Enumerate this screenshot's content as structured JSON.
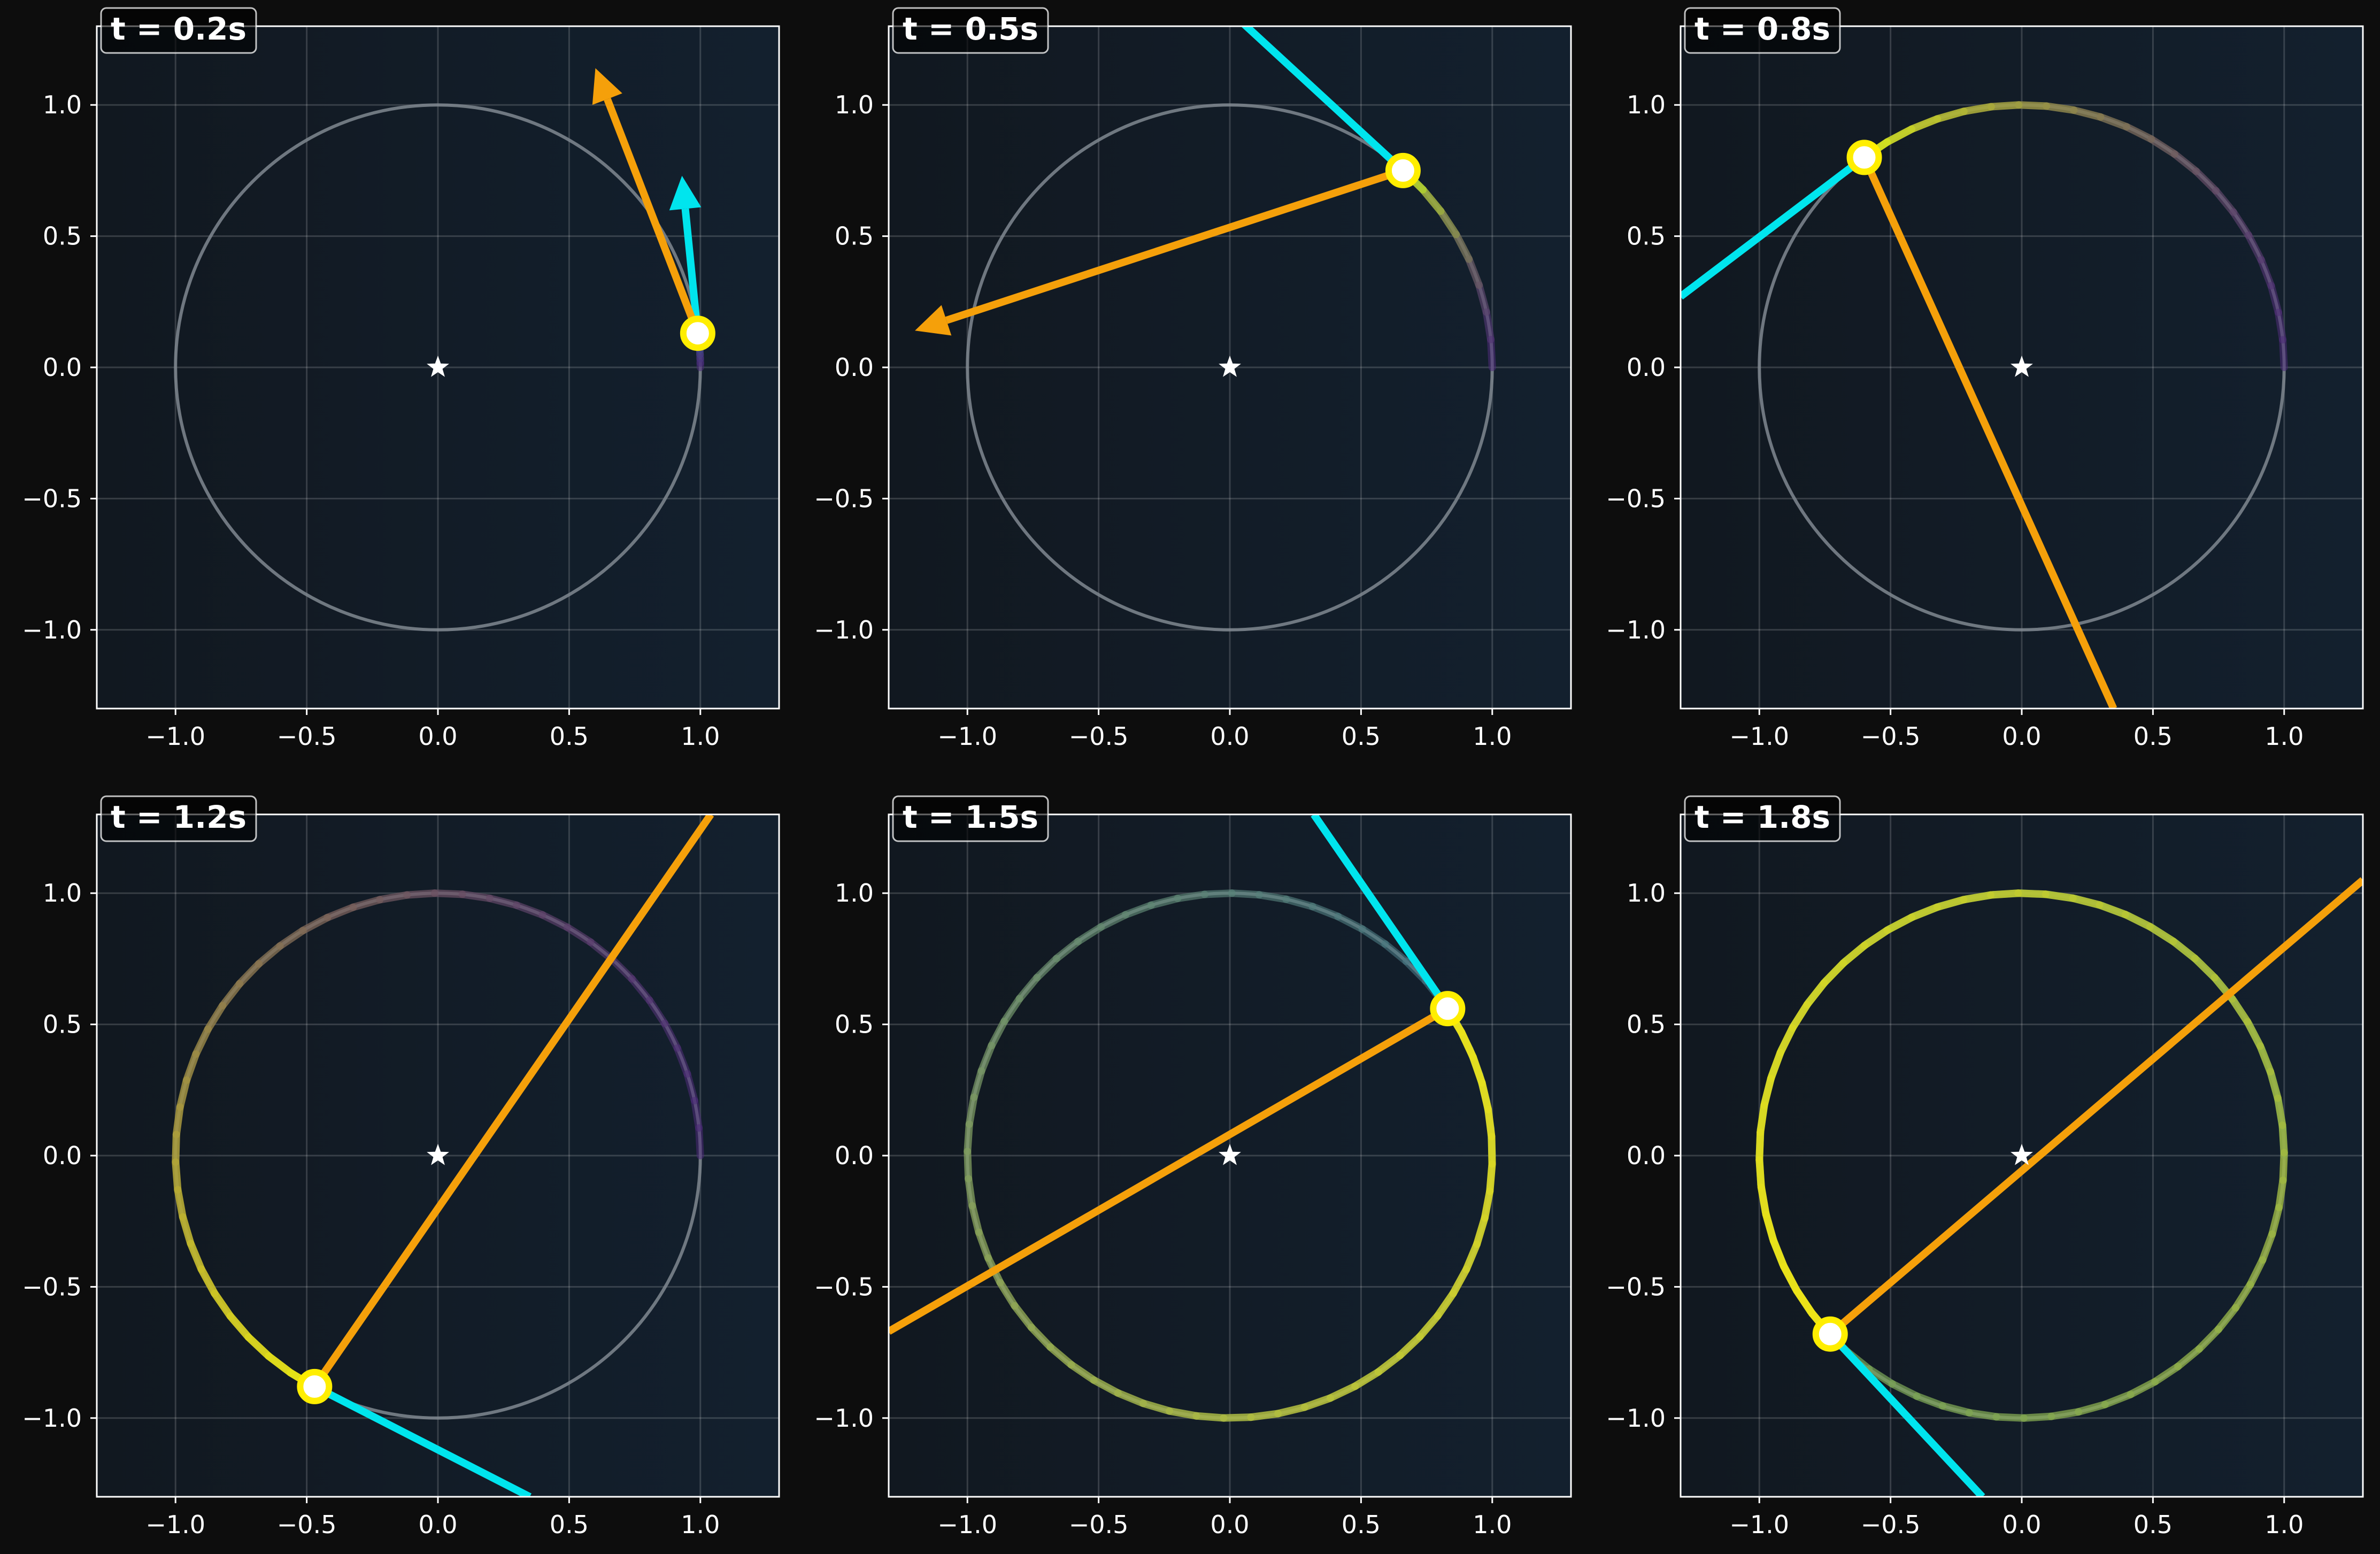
{
  "figure": {
    "background_color": "#0d0d0d",
    "axes_background_color": "#121a24",
    "circle_color": "#808890",
    "velocity_color": "#00e5ee",
    "acceleration_color": "#f5a00a",
    "point_fill_color": "#ffffff",
    "point_edge_color": "#ffee00",
    "center_marker": "star-icon"
  },
  "chart_data": [
    {
      "type": "line",
      "title": "t = 0.2s",
      "xlim": [
        -1.3,
        1.3
      ],
      "ylim": [
        -1.3,
        1.3
      ],
      "xticks": [
        "−1.0",
        "−0.5",
        "0.0",
        "0.5",
        "1.0"
      ],
      "yticks": [
        "−1.0",
        "−0.5",
        "0.0",
        "0.5",
        "1.0"
      ],
      "grid": true,
      "reference_circle": true,
      "center": [
        0,
        0
      ],
      "point": [
        0.99,
        0.13
      ],
      "trail": {
        "from_angle_deg": 0,
        "to_angle_deg": 7.6,
        "color_start": "#4b2a78",
        "color_end": "#2f6a96"
      },
      "velocity_line": {
        "from": [
          0.99,
          0.13
        ],
        "to": [
          0.93,
          0.73
        ],
        "arrow": true
      },
      "acceleration_line": {
        "from": [
          0.99,
          0.13
        ],
        "to": [
          0.6,
          1.14
        ],
        "arrow": true
      }
    },
    {
      "type": "line",
      "title": "t = 0.5s",
      "xlim": [
        -1.3,
        1.3
      ],
      "ylim": [
        -1.3,
        1.3
      ],
      "xticks": [
        "−1.0",
        "−0.5",
        "0.0",
        "0.5",
        "1.0"
      ],
      "yticks": [
        "−1.0",
        "−0.5",
        "0.0",
        "0.5",
        "1.0"
      ],
      "grid": true,
      "reference_circle": true,
      "center": [
        0,
        0
      ],
      "point": [
        0.66,
        0.75
      ],
      "trail": {
        "from_angle_deg": 0,
        "to_angle_deg": 48.7,
        "color_start": "#4b2a78",
        "color_end": "#b8dc2a"
      },
      "velocity_line": {
        "from": [
          0.66,
          0.75
        ],
        "to": [
          0.03,
          1.33
        ],
        "arrow": false
      },
      "acceleration_line": {
        "from": [
          0.66,
          0.75
        ],
        "to": [
          -1.2,
          0.14
        ],
        "arrow": true
      }
    },
    {
      "type": "line",
      "title": "t = 0.8s",
      "xlim": [
        -1.3,
        1.3
      ],
      "ylim": [
        -1.3,
        1.3
      ],
      "xticks": [
        "−1.0",
        "−0.5",
        "0.0",
        "0.5",
        "1.0"
      ],
      "yticks": [
        "−1.0",
        "−0.5",
        "0.0",
        "0.5",
        "1.0"
      ],
      "grid": true,
      "reference_circle": true,
      "center": [
        0,
        0
      ],
      "point": [
        -0.6,
        0.8
      ],
      "trail": {
        "from_angle_deg": 0,
        "to_angle_deg": 126.9,
        "color_start": "#4b2a78",
        "color_end": "#d4e61e"
      },
      "velocity_line": {
        "from": [
          -0.6,
          0.8
        ],
        "to": [
          -1.3,
          0.27
        ],
        "arrow": false
      },
      "acceleration_line": {
        "from": [
          -0.6,
          0.8
        ],
        "to": [
          0.35,
          -1.3
        ],
        "arrow": false
      }
    },
    {
      "type": "line",
      "title": "t = 1.2s",
      "xlim": [
        -1.3,
        1.3
      ],
      "ylim": [
        -1.3,
        1.3
      ],
      "xticks": [
        "−1.0",
        "−0.5",
        "0.0",
        "0.5",
        "1.0"
      ],
      "yticks": [
        "−1.0",
        "−0.5",
        "0.0",
        "0.5",
        "1.0"
      ],
      "grid": true,
      "reference_circle": true,
      "center": [
        0,
        0
      ],
      "point": [
        -0.47,
        -0.88
      ],
      "trail": {
        "from_angle_deg": 0,
        "to_angle_deg": 241.9,
        "color_start": "#4b2a78",
        "color_end": "#e8e614"
      },
      "velocity_line": {
        "from": [
          -0.47,
          -0.88
        ],
        "to": [
          0.35,
          -1.3
        ],
        "arrow": false
      },
      "acceleration_line": {
        "from": [
          -0.47,
          -0.88
        ],
        "to": [
          1.04,
          1.3
        ],
        "arrow": false
      }
    },
    {
      "type": "line",
      "title": "t = 1.5s",
      "xlim": [
        -1.3,
        1.3
      ],
      "ylim": [
        -1.3,
        1.3
      ],
      "xticks": [
        "−1.0",
        "−0.5",
        "0.0",
        "0.5",
        "1.0"
      ],
      "yticks": [
        "−1.0",
        "−0.5",
        "0.0",
        "0.5",
        "1.0"
      ],
      "grid": true,
      "reference_circle": true,
      "center": [
        0,
        0
      ],
      "point": [
        0.83,
        0.56
      ],
      "trail": {
        "from_angle_deg": 0,
        "to_angle_deg": 394,
        "color_start": "#3a6e8c",
        "color_end": "#ece41a"
      },
      "velocity_line": {
        "from": [
          0.83,
          0.56
        ],
        "to": [
          0.32,
          1.3
        ],
        "arrow": false
      },
      "acceleration_line": {
        "from": [
          0.83,
          0.56
        ],
        "to": [
          -1.3,
          -0.67
        ],
        "arrow": false
      }
    },
    {
      "type": "line",
      "title": "t = 1.8s",
      "xlim": [
        -1.3,
        1.3
      ],
      "ylim": [
        -1.3,
        1.3
      ],
      "xticks": [
        "−1.0",
        "−0.5",
        "0.0",
        "0.5",
        "1.0"
      ],
      "yticks": [
        "−1.0",
        "−0.5",
        "0.0",
        "0.5",
        "1.0"
      ],
      "grid": true,
      "reference_circle": true,
      "center": [
        0,
        0
      ],
      "point": [
        -0.73,
        -0.68
      ],
      "trail": {
        "from_angle_deg": 0,
        "to_angle_deg": 583,
        "color_start": "#3a7e78",
        "color_end": "#f0e616"
      },
      "velocity_line": {
        "from": [
          -0.73,
          -0.68
        ],
        "to": [
          -0.15,
          -1.3
        ],
        "arrow": false
      },
      "acceleration_line": {
        "from": [
          -0.73,
          -0.68
        ],
        "to": [
          1.3,
          1.05
        ],
        "arrow": false
      }
    }
  ]
}
